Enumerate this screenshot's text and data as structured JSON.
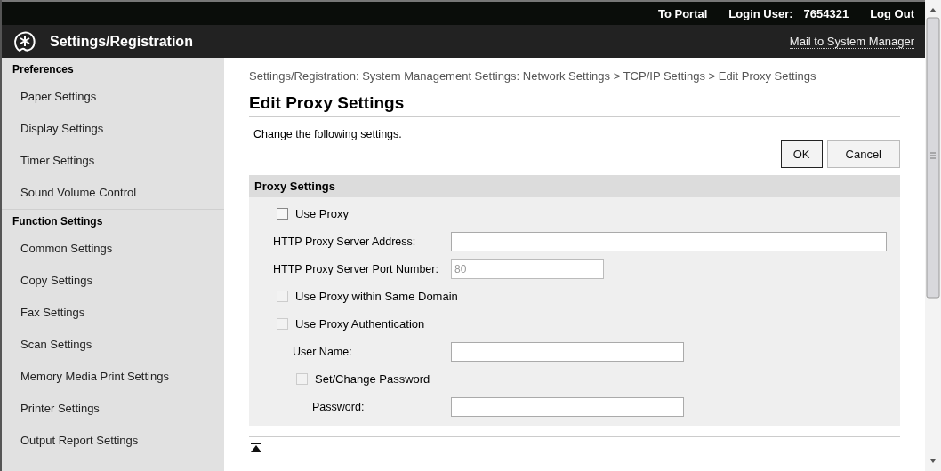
{
  "top_bar": {
    "links": [
      "To Portal"
    ],
    "login_label": "Login User:",
    "login_user": "7654321",
    "logout": "Log Out"
  },
  "header": {
    "title": "Settings/Registration",
    "mail_link": "Mail to System Manager"
  },
  "sidebar": {
    "sections": [
      {
        "title": "Preferences",
        "items": [
          "Paper Settings",
          "Display Settings",
          "Timer Settings",
          "Sound Volume Control"
        ]
      },
      {
        "title": "Function Settings",
        "items": [
          "Common Settings",
          "Copy Settings",
          "Fax Settings",
          "Scan Settings",
          "Memory Media Print Settings",
          "Printer Settings",
          "Output Report Settings"
        ]
      }
    ]
  },
  "breadcrumb": "Settings/Registration: System Management Settings: Network Settings > TCP/IP Settings > Edit Proxy Settings",
  "page_title": "Edit Proxy Settings",
  "instruction": "Change the following settings.",
  "buttons": [
    "OK",
    "Cancel"
  ],
  "section": {
    "title": "Proxy Settings",
    "rows": [
      {
        "kind": "checkbox",
        "label": "Use Proxy",
        "checked": false,
        "disabled": false
      },
      {
        "kind": "field",
        "label": "HTTP Proxy Server Address:",
        "disabled": false
      },
      {
        "kind": "field",
        "label": "HTTP Proxy Server Port Number:",
        "value": "80",
        "disabled": true
      },
      {
        "kind": "checkbox",
        "label": "Use Proxy within Same Domain",
        "checked": false,
        "disabled": true
      },
      {
        "kind": "checkbox",
        "label": "Use Proxy Authentication",
        "checked": false,
        "disabled": true,
        "children": [
          {
            "kind": "field",
            "label": "User Name:",
            "disabled": false
          },
          {
            "kind": "checkbox",
            "label": "Set/Change Password",
            "checked": false,
            "disabled": true,
            "children": [
              {
                "kind": "field",
                "label": "Password:",
                "disabled": false
              }
            ]
          }
        ]
      }
    ]
  }
}
